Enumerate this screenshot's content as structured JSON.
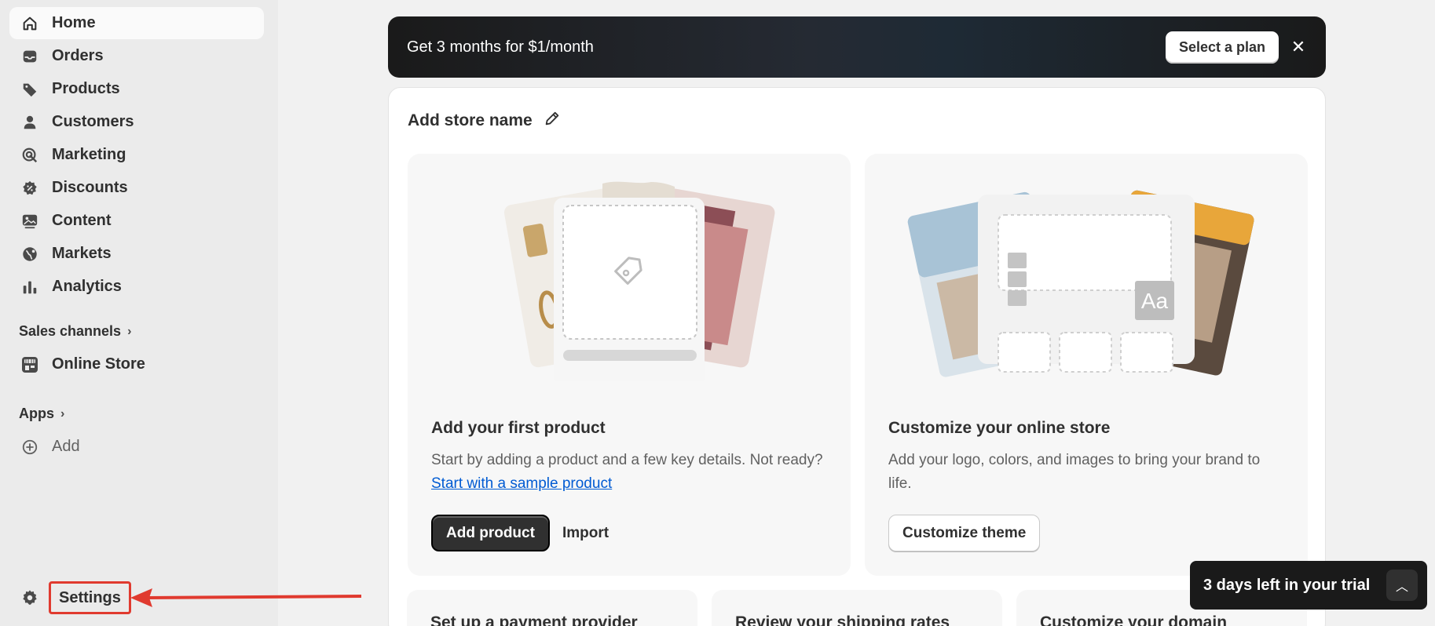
{
  "sidebar": {
    "items": [
      {
        "label": "Home",
        "icon": "home-icon"
      },
      {
        "label": "Orders",
        "icon": "inbox-icon"
      },
      {
        "label": "Products",
        "icon": "tag-icon"
      },
      {
        "label": "Customers",
        "icon": "person-icon"
      },
      {
        "label": "Marketing",
        "icon": "target-icon"
      },
      {
        "label": "Discounts",
        "icon": "discount-icon"
      },
      {
        "label": "Content",
        "icon": "image-icon"
      },
      {
        "label": "Markets",
        "icon": "globe-icon"
      },
      {
        "label": "Analytics",
        "icon": "bar-chart-icon"
      }
    ],
    "sales_channels_label": "Sales channels",
    "online_store_label": "Online Store",
    "apps_label": "Apps",
    "add_label": "Add",
    "settings_label": "Settings"
  },
  "banner": {
    "text": "Get 3 months for $1/month",
    "button_label": "Select a plan"
  },
  "store": {
    "name_prompt": "Add store name"
  },
  "cards": {
    "product": {
      "title": "Add your first product",
      "desc": "Start by adding a product and a few key details. Not ready?",
      "link": "Start with a sample product",
      "primary": "Add product",
      "secondary": "Import"
    },
    "theme": {
      "title": "Customize your online store",
      "desc": "Add your logo, colors, and images to bring your brand to life.",
      "button": "Customize theme",
      "illus_text": "Aa"
    }
  },
  "tasks": [
    {
      "title": "Set up a payment provider"
    },
    {
      "title": "Review your shipping rates"
    },
    {
      "title": "Customize your domain"
    }
  ],
  "trial": {
    "text": "3 days left in your trial"
  },
  "colors": {
    "accent_link": "#005bd3",
    "annotation_red": "#e03a2f"
  }
}
